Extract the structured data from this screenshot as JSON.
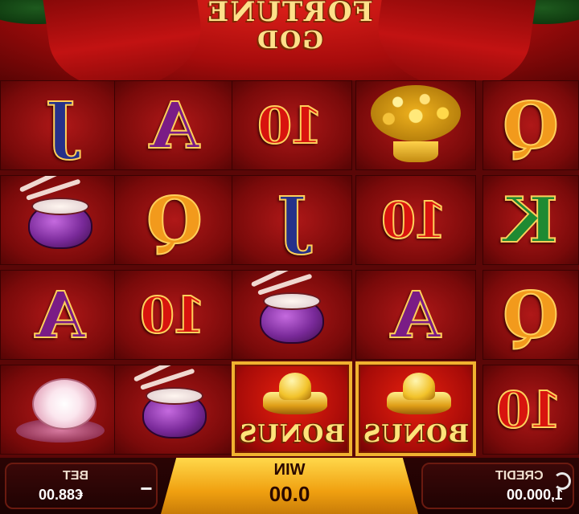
{
  "game": {
    "logo_line1": "FORTUNE",
    "logo_line2": "GOD"
  },
  "reels": {
    "columns": [
      [
        "J",
        "drum",
        "A",
        "peony"
      ],
      [
        "A",
        "Q",
        "10",
        "drum"
      ],
      [
        "10",
        "J",
        "drum",
        "bonus"
      ],
      [
        "money-tree",
        "10",
        "A",
        "bonus"
      ],
      [
        "Q",
        "K",
        "Q",
        "10"
      ]
    ],
    "bonus_label": "BONUS",
    "symbols": {
      "J": "J",
      "A": "A",
      "Q": "Q",
      "K": "K",
      "ten": "10"
    }
  },
  "bottom_bar": {
    "bet_label": "BET",
    "bet_value": "€88.00",
    "bet_decrease": "−",
    "win_label": "WIN",
    "win_value": "0.00",
    "credit_label": "CREDIT",
    "credit_value": "1,000.00"
  },
  "colors": {
    "ten": "#d8140e",
    "queen": "#f29a1c",
    "jack": "#26318a",
    "ace": "#7a1c86",
    "king": "#1e8a32",
    "win_bar": "#f0a010",
    "bonus_border": "#f0b230"
  }
}
